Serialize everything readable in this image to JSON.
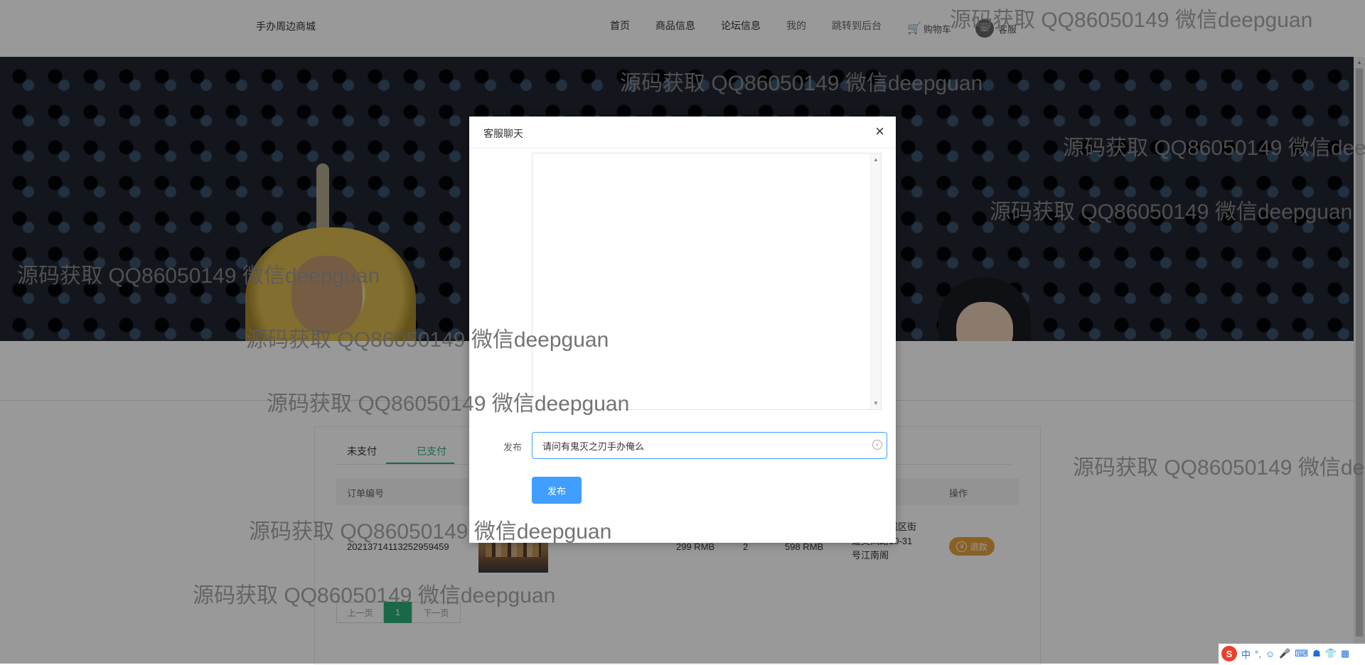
{
  "header": {
    "brand": "手办周边商城",
    "nav": {
      "home": "首页",
      "products": "商品信息",
      "forum": "论坛信息",
      "mine": "我的",
      "admin": "跳转到后台",
      "cart": "购物车",
      "service": "客服"
    }
  },
  "orders": {
    "tabs": [
      "未支付",
      "已支付"
    ],
    "active_tab": "已支付",
    "columns": {
      "order_no": "订单编号",
      "action": "操作"
    },
    "row": {
      "order_no": "20213714113252959459",
      "price": "299 RMB",
      "quantity": "2",
      "total": "598 RMB",
      "address": "州市梅区城区街道美凤路10-31号江南阁",
      "refund": "退款"
    },
    "pagination": {
      "prev": "上一页",
      "current": "1",
      "next": "下一页"
    }
  },
  "dialog": {
    "title": "客服聊天",
    "close": "×",
    "label": "发布",
    "input_value": "请问有鬼灭之刃手办俺么",
    "submit": "发布"
  },
  "watermark": "源码获取 QQ86050149 微信deepguan",
  "ime": {
    "logo": "S",
    "items": [
      "中",
      "°,",
      "☺",
      "🎤",
      "⌨",
      "☗",
      "👕",
      "▦"
    ]
  },
  "colors": {
    "accent_green": "#2ab07a",
    "primary_blue": "#409eff",
    "refund_orange": "#e6a23c"
  }
}
